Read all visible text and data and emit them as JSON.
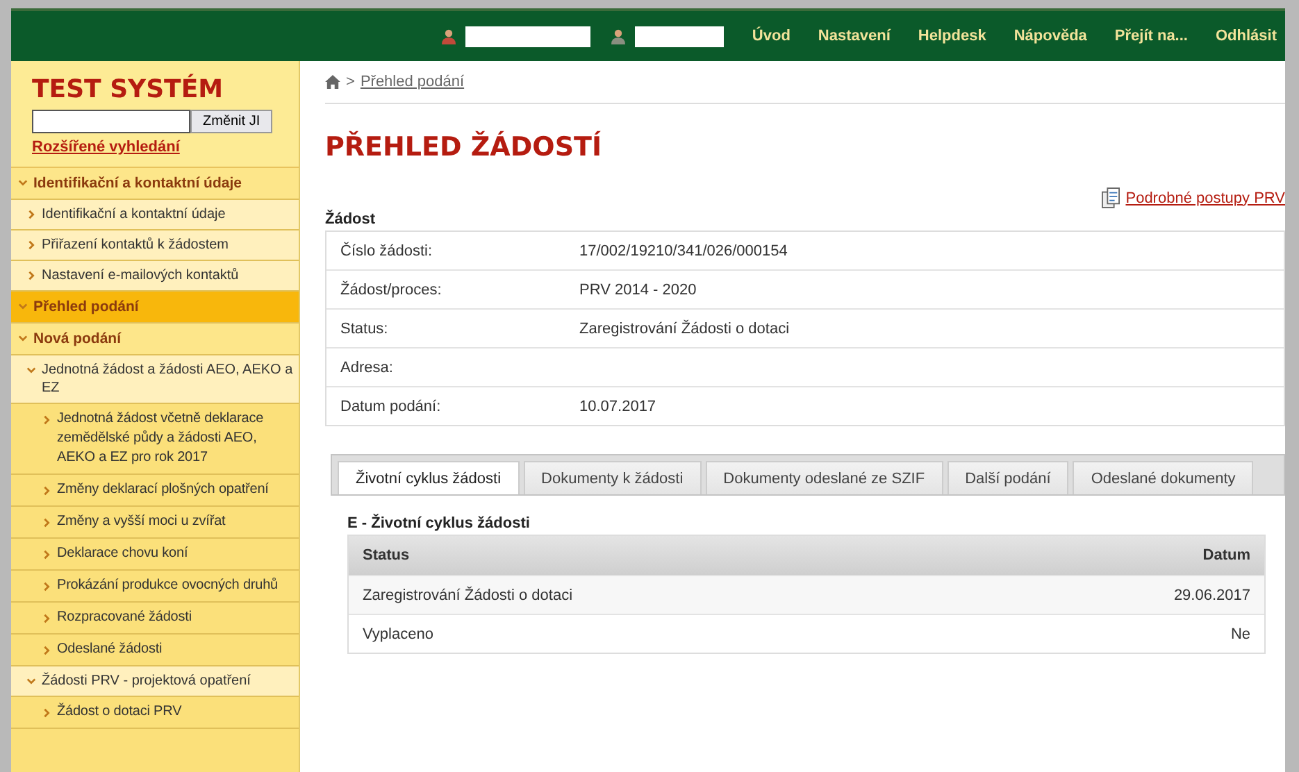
{
  "top_bar": {
    "nav": [
      {
        "label": "Úvod"
      },
      {
        "label": "Nastavení"
      },
      {
        "label": "Helpdesk"
      },
      {
        "label": "Nápověda"
      },
      {
        "label": "Přejít na..."
      },
      {
        "label": "Odhlásit"
      }
    ]
  },
  "sidebar": {
    "title": "TEST SYSTÉM",
    "search": {
      "button": "Změnit JI"
    },
    "advanced_link": "Rozšířené vyhledání",
    "items": [
      {
        "label": "Identifikační a kontaktní údaje",
        "selected": false,
        "expanded": true,
        "children": [
          {
            "label": "Identifikační a kontaktní údaje"
          },
          {
            "label": "Přiřazení kontaktů k žádostem"
          },
          {
            "label": "Nastavení e-mailových kontaktů"
          }
        ]
      },
      {
        "label": "Přehled podání",
        "selected": true,
        "expanded": true
      },
      {
        "label": "Nová podání",
        "selected": false,
        "expanded": true,
        "children": [
          {
            "label": "Jednotná žádost a žádosti AEO, AEKO a EZ",
            "expanded": true,
            "children": [
              {
                "label": "Jednotná žádost včetně deklarace zemědělské půdy a žádosti AEO, AEKO a EZ pro rok 2017"
              },
              {
                "label": "Změny deklarací plošných opatření"
              },
              {
                "label": "Změny a vyšší moci u zvířat"
              },
              {
                "label": "Deklarace chovu koní"
              },
              {
                "label": "Prokázání produkce ovocných druhů"
              },
              {
                "label": "Rozpracované žádosti"
              },
              {
                "label": "Odeslané žádosti"
              }
            ]
          },
          {
            "label": "Žádosti PRV - projektová opatření",
            "expanded": true,
            "children": [
              {
                "label": "Žádost o dotaci PRV"
              }
            ]
          }
        ]
      }
    ]
  },
  "breadcrumb": {
    "separator": ">",
    "link": "Přehled podání"
  },
  "page_title": "PŘEHLED ŽÁDOSTÍ",
  "procedures_link": "Podrobné postupy PRV",
  "request": {
    "heading": "Žádost",
    "fields": [
      {
        "label": "Číslo žádosti:",
        "value": "17/002/19210/341/026/000154"
      },
      {
        "label": "Žádost/proces:",
        "value": "PRV 2014 - 2020"
      },
      {
        "label": "Status:",
        "value": "Zaregistrování Žádosti o dotaci"
      },
      {
        "label": "Adresa:"
      },
      {
        "label": "Datum podání:",
        "value": "10.07.2017"
      }
    ]
  },
  "tabs": [
    {
      "label": "Životní cyklus žádosti",
      "selected": true
    },
    {
      "label": "Dokumenty k žádosti",
      "selected": false
    },
    {
      "label": "Dokumenty odeslané ze SZIF",
      "selected": false
    },
    {
      "label": "Další podání",
      "selected": false
    },
    {
      "label": "Odeslané dokumenty",
      "selected": false
    }
  ],
  "lifecycle": {
    "heading": "E - Životní cyklus žádosti",
    "columns": [
      "Status",
      "Datum"
    ],
    "rows": [
      {
        "status": "Zaregistrování Žádosti o dotaci",
        "date": "29.06.2017"
      },
      {
        "status": "Vyplaceno",
        "date": "Ne"
      }
    ]
  }
}
